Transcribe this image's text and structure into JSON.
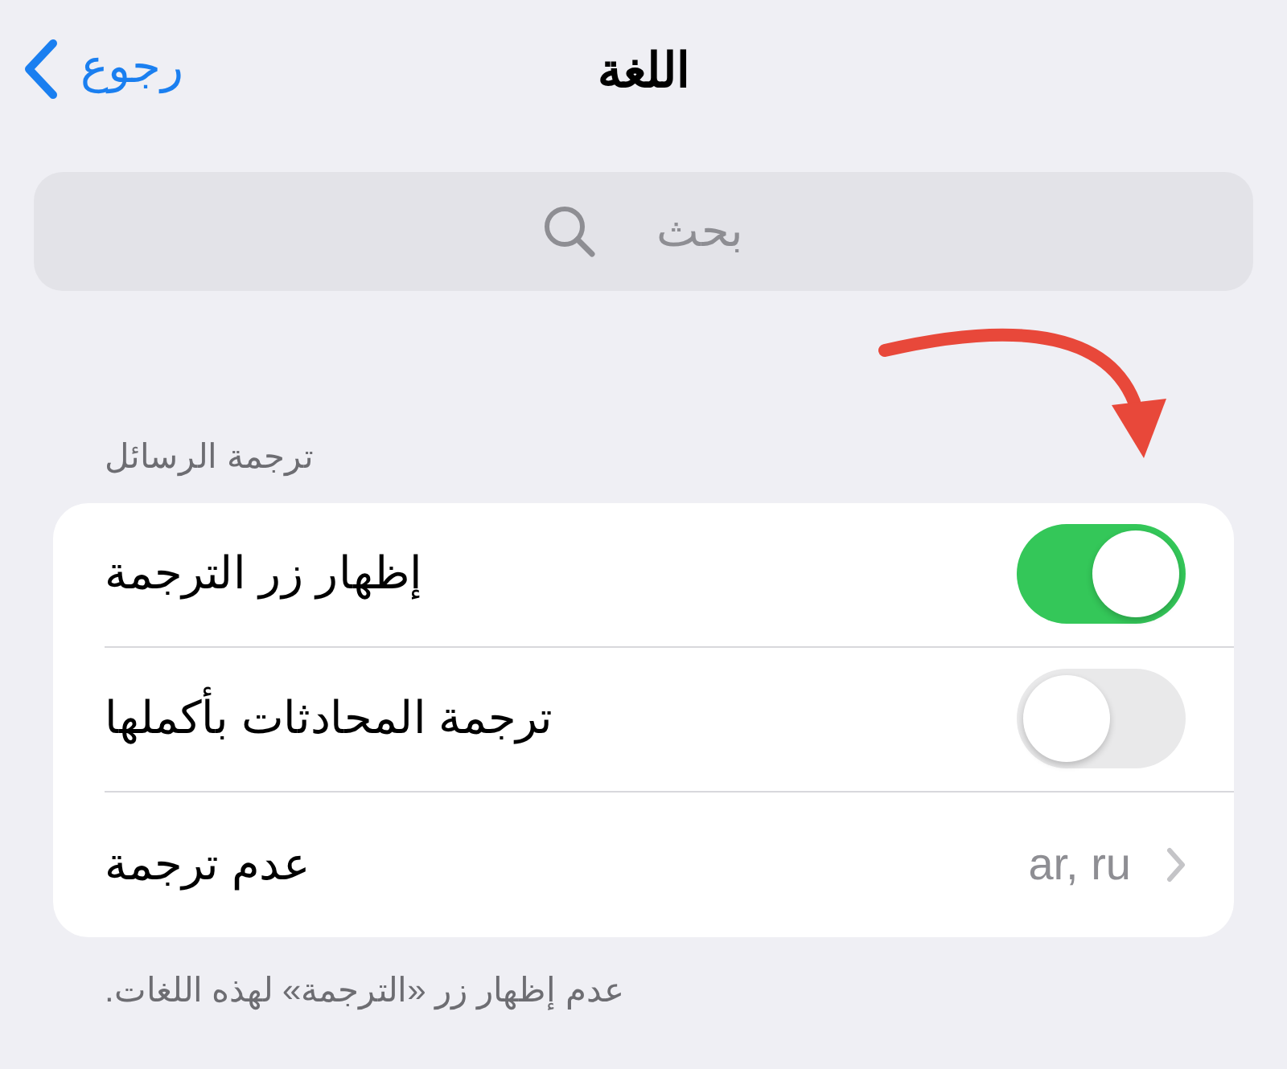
{
  "nav": {
    "back": "رجوع",
    "title": "اللغة"
  },
  "search": {
    "placeholder": "بحث"
  },
  "section": {
    "header": "ترجمة الرسائل",
    "rows": [
      {
        "kind": "toggle",
        "label": "إظهار زر الترجمة",
        "on": true
      },
      {
        "kind": "toggle",
        "label": "ترجمة المحادثات بأكملها",
        "on": false
      },
      {
        "kind": "disclosure",
        "label": "عدم ترجمة",
        "value": "ar, ru"
      }
    ],
    "footer": "عدم إظهار زر «الترجمة» لهذه اللغات."
  }
}
